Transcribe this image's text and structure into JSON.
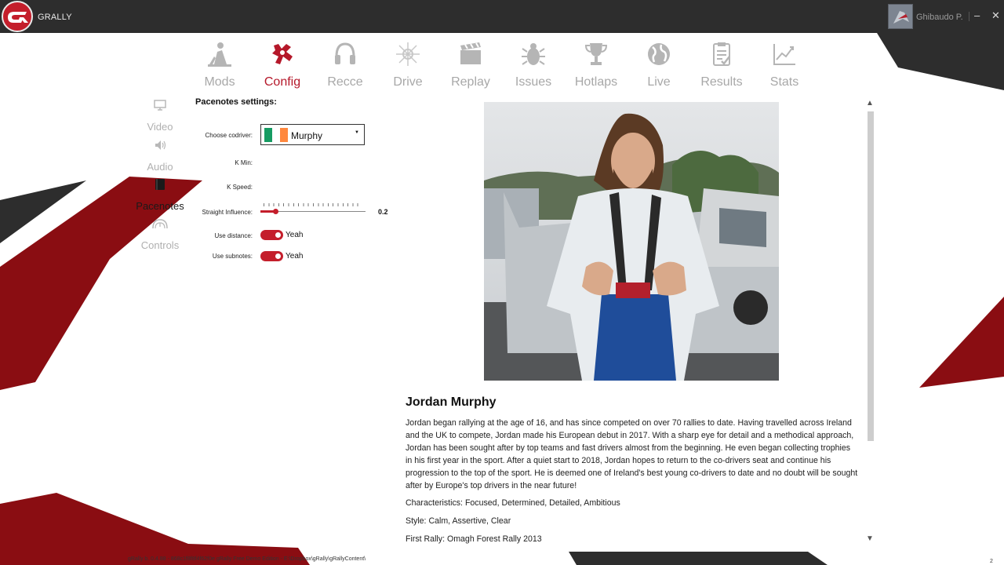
{
  "app": {
    "title": "GRALLY"
  },
  "user": {
    "name": "Ghibaudo P."
  },
  "window": {
    "minimize": "–",
    "close": "✕"
  },
  "colors": {
    "accent": "#c41e2b",
    "dark": "#2d2d2d",
    "maroon": "#8a0d12",
    "muted": "#a8a8a8"
  },
  "top_nav": [
    {
      "label": "Mods",
      "icon": "mechanic-icon",
      "active": false
    },
    {
      "label": "Config",
      "icon": "config-icon",
      "active": true
    },
    {
      "label": "Recce",
      "icon": "headphones-icon",
      "active": false
    },
    {
      "label": "Drive",
      "icon": "drive-icon",
      "active": false
    },
    {
      "label": "Replay",
      "icon": "clapperboard-icon",
      "active": false
    },
    {
      "label": "Issues",
      "icon": "bug-icon",
      "active": false
    },
    {
      "label": "Hotlaps",
      "icon": "trophy-icon",
      "active": false
    },
    {
      "label": "Live",
      "icon": "globe-icon",
      "active": false
    },
    {
      "label": "Results",
      "icon": "clipboard-icon",
      "active": false
    },
    {
      "label": "Stats",
      "icon": "chart-icon",
      "active": false
    }
  ],
  "sub_nav": [
    {
      "label": "Video",
      "icon": "monitor-icon",
      "active": false
    },
    {
      "label": "Audio",
      "icon": "speaker-icon",
      "active": false
    },
    {
      "label": "Pacenotes",
      "icon": "notebook-icon",
      "active": true
    },
    {
      "label": "Controls",
      "icon": "wheel-icon",
      "active": false
    }
  ],
  "settings": {
    "section_title": "Pacenotes settings:",
    "choose_codriver_label": "Choose codriver:",
    "codriver_value": "Murphy",
    "codriver_flag": [
      "#169b62",
      "#ffffff",
      "#ff883e"
    ],
    "select_arrow": "▼",
    "k_min_label": "K Min:",
    "k_speed_label": "K Speed:",
    "straight_influence_label": "Straight Influence:",
    "straight_influence_value": "0.2",
    "straight_influence_fraction": 0.14,
    "use_distance_label": "Use distance:",
    "use_distance_value": "Yeah",
    "use_subnotes_label": "Use subnotes:",
    "use_subnotes_value": "Yeah"
  },
  "bio": {
    "name": "Jordan Murphy",
    "text": "Jordan began rallying at the age of 16, and has since competed on over 70 rallies to date. Having travelled across Ireland and the UK to compete, Jordan made his European debut in 2017. With a sharp eye for detail and a methodical approach, Jordan has been sought after by top teams and fast drivers almost from the beginning. He even began collecting trophies in his first year in the sport. After a quiet start to 2018, Jordan hopes to return to the co-drivers seat and continue his progression to the top of the sport. He is deemed one of Ireland's best young co-drivers to date and no doubt will be sought after by Europe's top drivers in the near future!",
    "characteristics": "Characteristics: Focused, Determined, Detailed, Ambitious",
    "style": "Style: Calm, Assertive, Clear",
    "first_rally": "First Rally: Omagh Forest Rally 2013"
  },
  "scroll": {
    "up": "▲",
    "down": "▼"
  },
  "status": {
    "path": "gRally b. 0.4.88 - 868c1f8f8f4f62f0e gRally Free Demo Edition - E:\\Dropbox\\gRally\\gRallyContent\\",
    "corner": "2"
  }
}
